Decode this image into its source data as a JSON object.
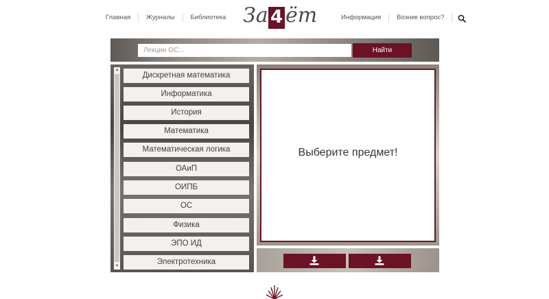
{
  "header": {
    "nav_left": [
      "Главная",
      "Журналы",
      "Библиотека"
    ],
    "nav_right": [
      "Информация",
      "Возник вопрос?"
    ],
    "logo": {
      "left": "За",
      "number": "4",
      "right": "ёт"
    }
  },
  "search": {
    "placeholder": "Лекции ОС...",
    "value": "",
    "button_label": "Найти"
  },
  "subjects": [
    "Дискретная математика",
    "Информатика",
    "История",
    "Математика",
    "Математическая логика",
    "ОАиП",
    "ОИПБ",
    "ОС",
    "Физика",
    "ЭПО ИД",
    "Электротехника"
  ],
  "content": {
    "message": "Выберите предмет!"
  },
  "colors": {
    "accent": "#6b1226",
    "panel_item_bg": "#f2f1ef"
  },
  "icons": {
    "search": "search-icon",
    "download": "download-icon"
  }
}
